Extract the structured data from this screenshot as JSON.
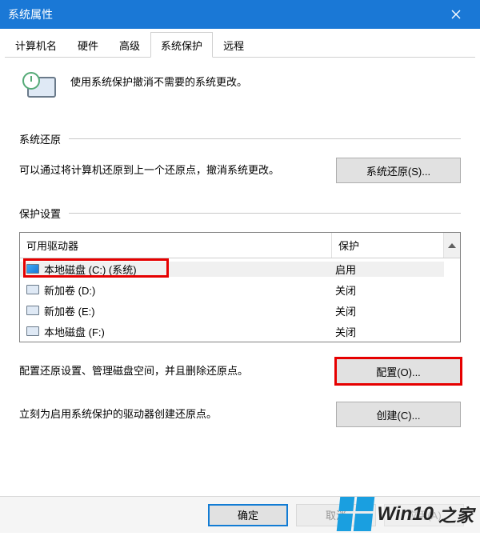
{
  "window": {
    "title": "系统属性"
  },
  "tabs": {
    "computer_name": "计算机名",
    "hardware": "硬件",
    "advanced": "高级",
    "system_protection": "系统保护",
    "remote": "远程"
  },
  "intro": "使用系统保护撤消不需要的系统更改。",
  "sections": {
    "restore_title": "系统还原",
    "settings_title": "保护设置"
  },
  "restore": {
    "desc": "可以通过将计算机还原到上一个还原点，撤消系统更改。",
    "button": "系统还原(S)..."
  },
  "table": {
    "col_drive": "可用驱动器",
    "col_protection": "保护",
    "rows": [
      {
        "name": "本地磁盘 (C:) (系统)",
        "status": "启用",
        "system": true
      },
      {
        "name": "新加卷 (D:)",
        "status": "关闭",
        "system": false
      },
      {
        "name": "新加卷 (E:)",
        "status": "关闭",
        "system": false
      },
      {
        "name": "本地磁盘 (F:)",
        "status": "关闭",
        "system": false
      }
    ]
  },
  "configure": {
    "desc": "配置还原设置、管理磁盘空间，并且删除还原点。",
    "button": "配置(O)..."
  },
  "create": {
    "desc": "立刻为启用系统保护的驱动器创建还原点。",
    "button": "创建(C)..."
  },
  "footer": {
    "ok": "确定",
    "cancel": "取消",
    "apply": "应用(A)"
  },
  "watermark": {
    "brand": "Win10",
    "suffix": "之家"
  }
}
